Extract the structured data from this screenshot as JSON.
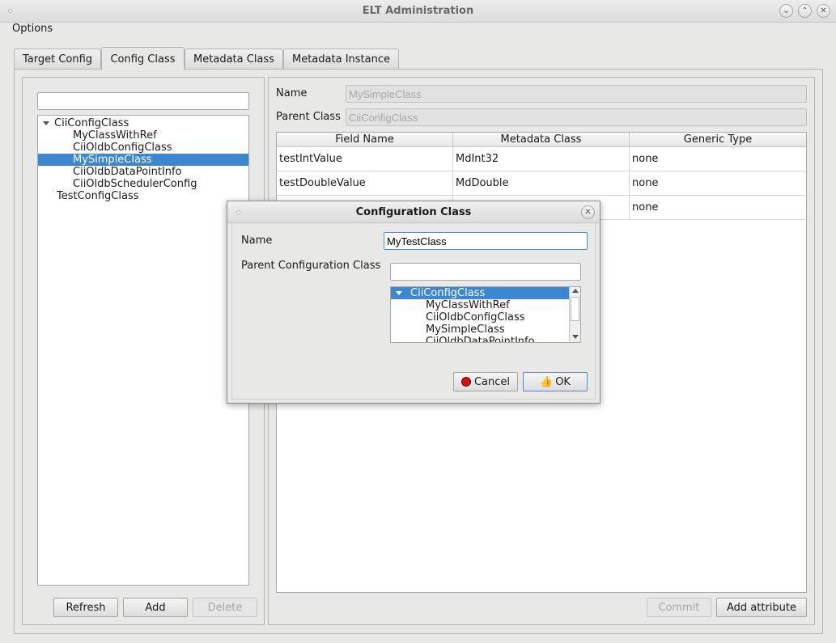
{
  "window": {
    "title": "ELT Administration",
    "controls": [
      "minimize",
      "maximize",
      "close"
    ]
  },
  "menu": {
    "options": "Options"
  },
  "tabs": [
    {
      "label": "Target Config",
      "active": false
    },
    {
      "label": "Config Class",
      "active": true
    },
    {
      "label": "Metadata Class",
      "active": false
    },
    {
      "label": "Metadata Instance",
      "active": false
    }
  ],
  "left_panel": {
    "filter_value": "",
    "tree": [
      {
        "label": "CiiConfigClass",
        "level": 0,
        "expanded": true,
        "selected": false
      },
      {
        "label": "MyClassWithRef",
        "level": 1,
        "selected": false
      },
      {
        "label": "CiiOldbConfigClass",
        "level": 1,
        "selected": false
      },
      {
        "label": "MySimpleClass",
        "level": 1,
        "selected": true
      },
      {
        "label": "CiiOldbDataPointInfo",
        "level": 1,
        "selected": false
      },
      {
        "label": "CiiOldbSchedulerConfig",
        "level": 1,
        "selected": false
      },
      {
        "label": "TestConfigClass",
        "level": 0,
        "selected": false
      }
    ],
    "buttons": {
      "refresh": "Refresh",
      "add": "Add",
      "delete": "Delete"
    }
  },
  "right_panel": {
    "name_label": "Name",
    "name_value": "MySimpleClass",
    "parent_label": "Parent Class",
    "parent_value": "CiiConfigClass",
    "table": {
      "headers": [
        "Field Name",
        "Metadata Class",
        "Generic Type"
      ],
      "rows": [
        [
          "testIntValue",
          "MdInt32",
          "none"
        ],
        [
          "testDoubleValue",
          "MdDouble",
          "none"
        ],
        [
          "",
          "",
          "none"
        ]
      ]
    },
    "buttons": {
      "commit": "Commit",
      "add_attribute": "Add attribute"
    }
  },
  "dialog": {
    "title": "Configuration Class",
    "name_label": "Name",
    "name_value": "MyTestClass",
    "parent_label": "Parent Configuration Class",
    "parent_filter_value": "",
    "tree": [
      {
        "label": "CiiConfigClass",
        "level": 0,
        "expanded": true,
        "selected": true
      },
      {
        "label": "MyClassWithRef",
        "level": 1,
        "selected": false
      },
      {
        "label": "CiiOldbConfigClass",
        "level": 1,
        "selected": false
      },
      {
        "label": "MySimpleClass",
        "level": 1,
        "selected": false
      },
      {
        "label": "CiiOldbDataPointInfo",
        "level": 1,
        "selected": false
      }
    ],
    "buttons": {
      "cancel": "Cancel",
      "ok": "OK"
    }
  },
  "icons": {
    "cancel": "red-circle-icon",
    "ok": "thumbs-up-icon"
  }
}
